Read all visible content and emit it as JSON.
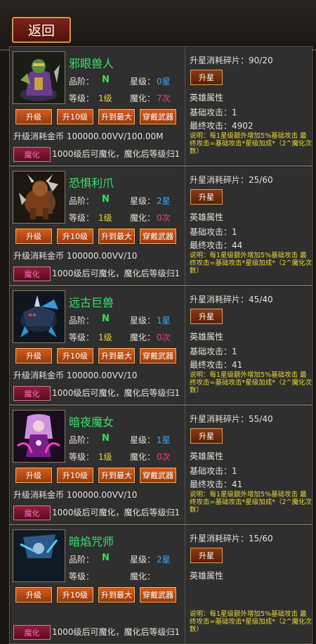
{
  "header": {
    "back_label": "返回"
  },
  "labels": {
    "rank": "品阶：",
    "star": "星级：",
    "level": "等级：",
    "demon": "魔化：",
    "btn_up": "升级",
    "btn_up10": "升10级",
    "btn_max": "升到最大",
    "btn_equip": "穿戴武器",
    "btn_demon": "魔化",
    "demon_note": "1000级后可魔化，魔化后等级归1",
    "btn_star": "升星",
    "attr_title": "英雄属性",
    "note": "说明：每1星级额外增加5%基础攻击 最终攻击=基础攻击*星级加成*（2^魔化次数）"
  },
  "heroes": [
    {
      "name": "邪眼兽人",
      "rank": "N",
      "star": "0星",
      "level": "1级",
      "demon": "7次",
      "cost": "升级消耗金币 100000.00VV/100.00M",
      "frag": "升星消耗碎片：90/20",
      "base": "基础攻击：1",
      "final": "最终攻击：4902",
      "art": "orc"
    },
    {
      "name": "恐惧利爪",
      "rank": "N",
      "star": "2星",
      "level": "1级",
      "demon": "0次",
      "cost": "升级消耗金币 100000.00VV/10",
      "frag": "升星消耗碎片：25/60",
      "base": "基础攻击：1",
      "final": "最终攻击：44",
      "art": "beast"
    },
    {
      "name": "远古巨兽",
      "rank": "N",
      "star": "1星",
      "level": "1级",
      "demon": "0次",
      "cost": "升级消耗金币 100000.00VV/10",
      "frag": "升星消耗碎片：45/40",
      "base": "基础攻击：1",
      "final": "最终攻击：41",
      "art": "wolf"
    },
    {
      "name": "暗夜魔女",
      "rank": "N",
      "star": "1星",
      "level": "1级",
      "demon": "0次",
      "cost": "升级消耗金币 100000.00VV/10",
      "frag": "升星消耗碎片：55/40",
      "base": "基础攻击：1",
      "final": "最终攻击：41",
      "art": "witch"
    },
    {
      "name": "暗焰咒师",
      "rank": "N",
      "star": "2星",
      "level": "",
      "demon": "",
      "cost": "",
      "frag": "升星消耗碎片：15/60",
      "base": "",
      "final": "",
      "art": "mage"
    }
  ]
}
